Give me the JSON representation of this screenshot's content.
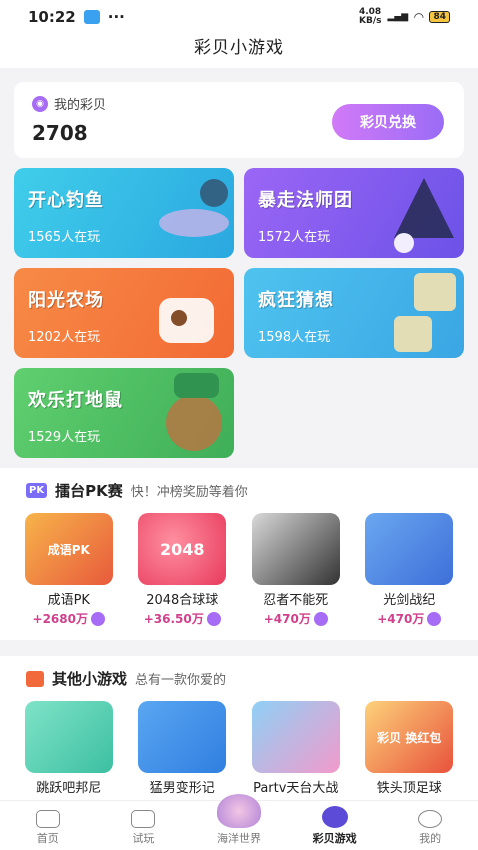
{
  "status": {
    "time": "10:22",
    "speed": "4.08\nKB/s",
    "battery": "84"
  },
  "header": {
    "title": "彩贝小游戏"
  },
  "balance": {
    "label": "我的彩贝",
    "value": "2708",
    "exchange_button": "彩贝兑换"
  },
  "featured_games": [
    {
      "title": "开心钓鱼",
      "players": "1565人在玩",
      "color": "#33c3e8"
    },
    {
      "title": "暴走法师团",
      "players": "1572人在玩",
      "color": "#8a5cf3"
    },
    {
      "title": "阳光农场",
      "players": "1202人在玩",
      "color": "#f47d3f"
    },
    {
      "title": "疯狂猜想",
      "players": "1598人在玩",
      "color": "#36b6ea"
    },
    {
      "title": "欢乐打地鼠",
      "players": "1529人在玩",
      "color": "#4bbf6a"
    }
  ],
  "pk_section": {
    "badge": "PK",
    "title": "擂台PK赛",
    "subtitle": "快！冲榜奖励等着你",
    "games": [
      {
        "name": "成语PK",
        "reward": "+2680万",
        "thumb_text": "成语PK",
        "color": "#e85a3c"
      },
      {
        "name": "2048合球球",
        "reward": "+36.50万",
        "thumb_text": "2048",
        "color": "#f0506a"
      },
      {
        "name": "忍者不能死",
        "reward": "+470万",
        "thumb_text": "",
        "color": "#333333"
      },
      {
        "name": "光剑战纪",
        "reward": "+470万",
        "thumb_text": "",
        "color": "#3e6fd8"
      }
    ]
  },
  "other_section": {
    "title": "其他小游戏",
    "subtitle": "总有一款你爱的",
    "games": [
      {
        "name": "跳跃吧邦尼",
        "thumb_text": "",
        "color": "#4fd1b5"
      },
      {
        "name": "猛男变形记",
        "thumb_text": "",
        "color": "#2f7fe0"
      },
      {
        "name": "Partv天台大战",
        "thumb_text": "",
        "color": "#f29acb"
      },
      {
        "name": "铁头顶足球",
        "thumb_text": "彩贝 换红包",
        "color": "#f7a23d"
      }
    ]
  },
  "bottom_nav": [
    {
      "label": "首页",
      "icon": "home-icon"
    },
    {
      "label": "试玩",
      "icon": "gamepad-icon"
    },
    {
      "label": "海洋世界",
      "icon": "shell-icon"
    },
    {
      "label": "彩贝游戏",
      "icon": "game-icon"
    },
    {
      "label": "我的",
      "icon": "profile-icon"
    }
  ]
}
